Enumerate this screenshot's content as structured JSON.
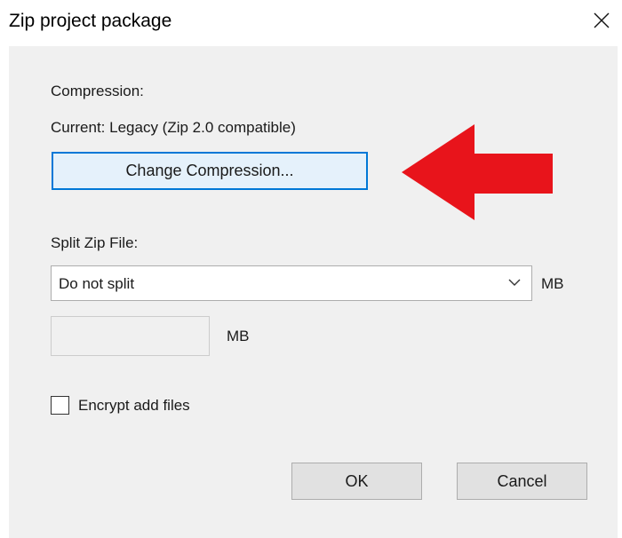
{
  "window": {
    "title": "Zip project package",
    "close_icon": "close-icon"
  },
  "compression": {
    "heading": "Compression:",
    "current": "Current: Legacy (Zip 2.0 compatible)",
    "change_button_label": "Change Compression..."
  },
  "split": {
    "heading": "Split Zip File:",
    "selected_option": "Do not split",
    "dropdown_unit": "MB",
    "custom_size_value": "",
    "custom_size_unit": "MB"
  },
  "encrypt": {
    "label": "Encrypt add files",
    "checked": false
  },
  "actions": {
    "ok_label": "OK",
    "cancel_label": "Cancel"
  },
  "annotation": {
    "arrow_color": "#e8141b",
    "arrow_icon": "red-arrow-left-icon"
  },
  "colors": {
    "focus_border": "#0078d7",
    "button_face": "#e1e1e1",
    "dialog_background": "#f0f0f0"
  }
}
